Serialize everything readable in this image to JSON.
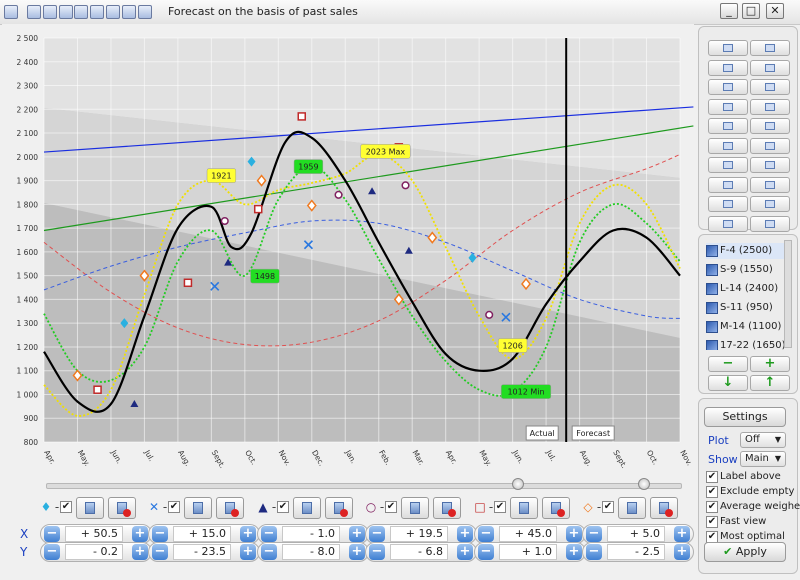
{
  "window": {
    "title": "Forecast on the basis of past sales",
    "min_glyph": "_",
    "max_glyph": "□",
    "close_glyph": "✕"
  },
  "chart_data": {
    "type": "line",
    "ylim": [
      800,
      2500
    ],
    "yticks": [
      "800",
      "900",
      "1 000",
      "1 100",
      "1 200",
      "1 300",
      "1 400",
      "1 500",
      "1 600",
      "1 700",
      "1 800",
      "1 900",
      "2 000",
      "2 100",
      "2 200",
      "2 300",
      "2 400",
      "2 500"
    ],
    "x_labels": [
      "Apr.",
      "May.",
      "Jun.",
      "Jul.",
      "Aug.",
      "Sept.",
      "Oct.",
      "Nov.",
      "Dec.",
      "Jan.",
      "Feb.",
      "Mar.",
      "Apr.",
      "May.",
      "Jun.",
      "Jul.",
      "Aug.",
      "Sept.",
      "Oct.",
      "Nov."
    ],
    "annotations": [
      {
        "text": "1921",
        "x": 5.3,
        "y": 1921,
        "color": "#ffff33"
      },
      {
        "text": "1959",
        "x": 7.9,
        "y": 1959,
        "color": "#22dd22"
      },
      {
        "text": "2023 Max",
        "x": 10.2,
        "y": 2023,
        "color": "#ffff33"
      },
      {
        "text": "1498",
        "x": 6.6,
        "y": 1498,
        "color": "#22dd22"
      },
      {
        "text": "1206",
        "x": 14.0,
        "y": 1206,
        "color": "#ffff33"
      },
      {
        "text": "1012 Min",
        "x": 14.4,
        "y": 1012,
        "color": "#22dd22"
      }
    ],
    "region_labels": {
      "actual": "Actual",
      "forecast": "Forecast"
    },
    "forecast_split_x": 15.6,
    "series": [
      {
        "kind": "main",
        "color": "#000000",
        "points": [
          [
            0,
            1180
          ],
          [
            1,
            970
          ],
          [
            2,
            960
          ],
          [
            3,
            1330
          ],
          [
            4,
            1700
          ],
          [
            5,
            1790
          ],
          [
            5.6,
            1620
          ],
          [
            6.2,
            1680
          ],
          [
            7.2,
            2060
          ],
          [
            8,
            2080
          ],
          [
            9,
            1900
          ],
          [
            10,
            1640
          ],
          [
            11,
            1390
          ],
          [
            12,
            1170
          ],
          [
            13,
            1100
          ],
          [
            14,
            1150
          ],
          [
            15,
            1380
          ],
          [
            16,
            1560
          ],
          [
            17,
            1690
          ],
          [
            18,
            1660
          ],
          [
            19,
            1500
          ]
        ]
      },
      {
        "kind": "yellow-dotted",
        "color": "#f0e000",
        "points": [
          [
            0,
            1040
          ],
          [
            1,
            910
          ],
          [
            2,
            1020
          ],
          [
            3,
            1420
          ],
          [
            4,
            1800
          ],
          [
            5,
            1900
          ],
          [
            6,
            1800
          ],
          [
            7,
            1860
          ],
          [
            8,
            1890
          ],
          [
            9,
            1930
          ],
          [
            10,
            2010
          ],
          [
            11,
            1900
          ],
          [
            12,
            1620
          ],
          [
            13,
            1330
          ],
          [
            14,
            1150
          ],
          [
            15,
            1320
          ],
          [
            16,
            1720
          ],
          [
            17,
            1880
          ],
          [
            18,
            1800
          ],
          [
            19,
            1530
          ]
        ]
      },
      {
        "kind": "green-dotted",
        "color": "#22cc22",
        "points": [
          [
            0,
            1340
          ],
          [
            1,
            1100
          ],
          [
            2,
            1060
          ],
          [
            3,
            1200
          ],
          [
            4,
            1560
          ],
          [
            5,
            1690
          ],
          [
            6,
            1500
          ],
          [
            7,
            1820
          ],
          [
            8,
            1960
          ],
          [
            9,
            1820
          ],
          [
            10,
            1570
          ],
          [
            11,
            1330
          ],
          [
            12,
            1140
          ],
          [
            13,
            1020
          ],
          [
            14,
            1010
          ],
          [
            15,
            1200
          ],
          [
            16,
            1640
          ],
          [
            17,
            1800
          ],
          [
            18,
            1720
          ],
          [
            19,
            1560
          ]
        ]
      },
      {
        "kind": "blue-dashed",
        "color": "#3a5fe0",
        "points": [
          [
            0,
            1440
          ],
          [
            2,
            1540
          ],
          [
            4,
            1620
          ],
          [
            6,
            1680
          ],
          [
            8,
            1730
          ],
          [
            10,
            1720
          ],
          [
            12,
            1640
          ],
          [
            14,
            1520
          ],
          [
            16,
            1400
          ],
          [
            18,
            1330
          ],
          [
            19,
            1320
          ]
        ]
      },
      {
        "kind": "red-dashed",
        "color": "#e05050",
        "points": [
          [
            0,
            1640
          ],
          [
            2,
            1430
          ],
          [
            4,
            1280
          ],
          [
            6,
            1210
          ],
          [
            8,
            1220
          ],
          [
            10,
            1310
          ],
          [
            12,
            1480
          ],
          [
            14,
            1690
          ],
          [
            16,
            1850
          ],
          [
            18,
            1950
          ],
          [
            19,
            2010
          ]
        ]
      }
    ],
    "trend_lines": [
      {
        "color": "#1a2ee0",
        "from": [
          0,
          2020
        ],
        "to": [
          19.4,
          2210
        ]
      },
      {
        "color": "#1e9a1e",
        "from": [
          0,
          1690
        ],
        "to": [
          19.4,
          2130
        ]
      }
    ],
    "markers": [
      {
        "sym": "diamond",
        "color": "#2ab0e0",
        "pts": [
          [
            2.4,
            1300
          ],
          [
            6.2,
            1980
          ],
          [
            12.8,
            1575
          ]
        ]
      },
      {
        "sym": "x",
        "color": "#2a78e0",
        "pts": [
          [
            5.1,
            1455
          ],
          [
            7.9,
            1630
          ],
          [
            13.8,
            1325
          ]
        ]
      },
      {
        "sym": "triangle",
        "color": "#1e2a80",
        "pts": [
          [
            2.7,
            960
          ],
          [
            5.5,
            1555
          ],
          [
            9.8,
            1855
          ],
          [
            10.9,
            1605
          ]
        ]
      },
      {
        "sym": "circle",
        "color": "#802060",
        "pts": [
          [
            5.4,
            1730
          ],
          [
            8.8,
            1840
          ],
          [
            10.8,
            1880
          ],
          [
            13.3,
            1335
          ]
        ]
      },
      {
        "sym": "square",
        "color": "#c02a2a",
        "pts": [
          [
            1.6,
            1020
          ],
          [
            4.3,
            1470
          ],
          [
            6.4,
            1780
          ],
          [
            7.7,
            2170
          ],
          [
            10.6,
            2040
          ]
        ]
      },
      {
        "sym": "diamond-o",
        "color": "#f07a20",
        "pts": [
          [
            1.0,
            1080
          ],
          [
            3.0,
            1500
          ],
          [
            6.5,
            1900
          ],
          [
            8.0,
            1795
          ],
          [
            10.6,
            1400
          ],
          [
            11.6,
            1660
          ],
          [
            14.4,
            1465
          ]
        ]
      }
    ]
  },
  "series_controls": [
    {
      "marker": "♦",
      "marker_color": "#2ab0e0",
      "x": "+ 50.5",
      "y": "- 0.2"
    },
    {
      "marker": "✕",
      "marker_color": "#2a78e0",
      "x": "+ 15.0",
      "y": "- 23.5"
    },
    {
      "marker": "▲",
      "marker_color": "#1e2a80",
      "x": "- 1.0",
      "y": "- 8.0"
    },
    {
      "marker": "○",
      "marker_color": "#802060",
      "x": "+ 19.5",
      "y": "- 6.8"
    },
    {
      "marker": "□",
      "marker_color": "#c02a2a",
      "x": "+ 45.0",
      "y": "+ 1.0"
    },
    {
      "marker": "◇",
      "marker_color": "#f07a20",
      "x": "+ 5.0",
      "y": "- 2.5"
    }
  ],
  "axis_labels": {
    "x": "X",
    "y": "Y"
  },
  "products": [
    {
      "label": "F-4 (2500)"
    },
    {
      "label": "S-9 (1550)"
    },
    {
      "label": "L-14 (2400)"
    },
    {
      "label": "S-11 (950)"
    },
    {
      "label": "M-14 (1100)"
    },
    {
      "label": "17-22 (1650)"
    }
  ],
  "settings": {
    "button_label": "Settings",
    "plot_label": "Plot",
    "plot_value": "Off",
    "show_label": "Show",
    "show_value": "Main",
    "options": [
      {
        "label": "Label above",
        "checked": true
      },
      {
        "label": "Exclude empty",
        "checked": true
      },
      {
        "label": "Average weighed",
        "checked": true
      },
      {
        "label": "Fast view",
        "checked": true
      },
      {
        "label": "Most optimal",
        "checked": true
      }
    ],
    "apply_label": "Apply",
    "check_glyph": "✔"
  },
  "list_buttons": {
    "minus": "−",
    "plus": "+",
    "down": "↓",
    "up": "↑"
  }
}
